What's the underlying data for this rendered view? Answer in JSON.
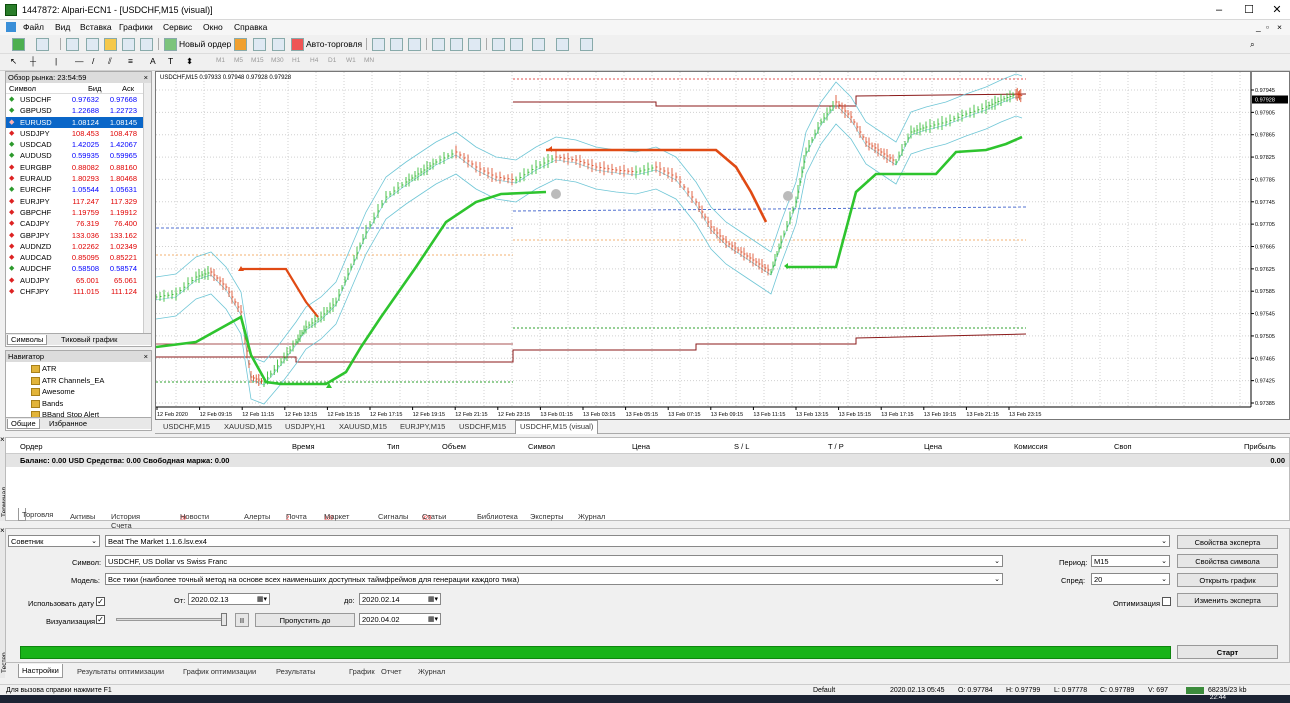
{
  "window": {
    "title": "1447872: Alpari-ECN1 - [USDCHF,M15 (visual)]"
  },
  "menu": [
    "Файл",
    "Вид",
    "Вставка",
    "Графики",
    "Сервис",
    "Окно",
    "Справка"
  ],
  "toolbar": {
    "new_order": "Новый ордер",
    "autotrading": "Авто-торговля",
    "timeframes": [
      "M1",
      "M5",
      "M15",
      "M30",
      "H1",
      "H4",
      "D1",
      "W1",
      "MN"
    ]
  },
  "market_watch": {
    "title": "Обзор рынка: 23:54:59",
    "col_symbol": "Символ",
    "col_bid": "Бид",
    "col_ask": "Аск",
    "rows": [
      {
        "symbol": "USDCHF",
        "bid": "0.97632",
        "ask": "0.97668",
        "dir": "up"
      },
      {
        "symbol": "GBPUSD",
        "bid": "1.22688",
        "ask": "1.22723",
        "dir": "up"
      },
      {
        "symbol": "EURUSD",
        "bid": "1.08124",
        "ask": "1.08145",
        "dir": "sel"
      },
      {
        "symbol": "USDJPY",
        "bid": "108.453",
        "ask": "108.478",
        "dir": "dn"
      },
      {
        "symbol": "USDCAD",
        "bid": "1.42025",
        "ask": "1.42067",
        "dir": "up"
      },
      {
        "symbol": "AUDUSD",
        "bid": "0.59935",
        "ask": "0.59965",
        "dir": "up"
      },
      {
        "symbol": "EURGBP",
        "bid": "0.88082",
        "ask": "0.88160",
        "dir": "dn"
      },
      {
        "symbol": "EURAUD",
        "bid": "1.80293",
        "ask": "1.80468",
        "dir": "dn"
      },
      {
        "symbol": "EURCHF",
        "bid": "1.05544",
        "ask": "1.05631",
        "dir": "up"
      },
      {
        "symbol": "EURJPY",
        "bid": "117.247",
        "ask": "117.329",
        "dir": "dn"
      },
      {
        "symbol": "GBPCHF",
        "bid": "1.19759",
        "ask": "1.19912",
        "dir": "dn"
      },
      {
        "symbol": "CADJPY",
        "bid": "76.319",
        "ask": "76.400",
        "dir": "dn"
      },
      {
        "symbol": "GBPJPY",
        "bid": "133.036",
        "ask": "133.162",
        "dir": "dn"
      },
      {
        "symbol": "AUDNZD",
        "bid": "1.02262",
        "ask": "1.02349",
        "dir": "dn"
      },
      {
        "symbol": "AUDCAD",
        "bid": "0.85095",
        "ask": "0.85221",
        "dir": "dn"
      },
      {
        "symbol": "AUDCHF",
        "bid": "0.58508",
        "ask": "0.58574",
        "dir": "up"
      },
      {
        "symbol": "AUDJPY",
        "bid": "65.001",
        "ask": "65.061",
        "dir": "dn"
      },
      {
        "symbol": "CHFJPY",
        "bid": "111.015",
        "ask": "111.124",
        "dir": "dn"
      }
    ],
    "tabs": [
      "Символы",
      "Тиковый график"
    ]
  },
  "navigator": {
    "title": "Навигатор",
    "items": [
      "ATR",
      "ATR Channels_EA",
      "Awesome",
      "Bands",
      "BBand Stop Alert"
    ],
    "tabs": [
      "Общие",
      "Избранное"
    ]
  },
  "chart": {
    "info": "USDCHF,M15  0.97933 0.97948 0.97928 0.97928",
    "current_price": "0.97928",
    "price_labels": [
      "0.97945",
      "0.97905",
      "0.97865",
      "0.97825",
      "0.97785",
      "0.97745",
      "0.97705",
      "0.97665",
      "0.97625",
      "0.97585",
      "0.97545",
      "0.97505",
      "0.97465",
      "0.97425",
      "0.97385"
    ],
    "time_labels": [
      "12 Feb 2020",
      "12 Feb 09:15",
      "12 Feb 11:15",
      "12 Feb 13:15",
      "12 Feb 15:15",
      "12 Feb 17:15",
      "12 Feb 19:15",
      "12 Feb 21:15",
      "12 Feb 23:15",
      "13 Feb 01:15",
      "13 Feb 03:15",
      "13 Feb 05:15",
      "13 Feb 07:15",
      "13 Feb 09:15",
      "13 Feb 11:15",
      "13 Feb 13:15",
      "13 Feb 15:15",
      "13 Feb 17:15",
      "13 Feb 19:15",
      "13 Feb 21:15",
      "13 Feb 23:15"
    ],
    "colors": {
      "bull": "#22b422",
      "bear": "#d9401a",
      "band": "#6fc6d6",
      "envelope": "#8b1a1a",
      "trail_up": "#2ec42e",
      "trail_dn": "#e04a14"
    }
  },
  "chart_tabs": [
    "USDCHF,M15",
    "XAUUSD,M15",
    "USDJPY,H1",
    "XAUUSD,M15",
    "EURJPY,M15",
    "USDCHF,M15",
    "USDCHF,M15 (visual)"
  ],
  "terminal": {
    "columns": [
      "Ордер",
      "Время",
      "Тип",
      "Объем",
      "Символ",
      "Цена",
      "S / L",
      "T / P",
      "Цена",
      "Комиссия",
      "Своп",
      "Прибыль"
    ],
    "balance": "Баланс: 0.00 USD  Средства: 0.00  Свободная маржа: 0.00",
    "balance_profit": "0.00",
    "side_label": "Терминал",
    "tabs": [
      {
        "label": "Торговля",
        "badge": ""
      },
      {
        "label": "Активы",
        "badge": ""
      },
      {
        "label": "История Счета",
        "badge": ""
      },
      {
        "label": "Новости",
        "badge": "28"
      },
      {
        "label": "Алерты",
        "badge": ""
      },
      {
        "label": "Почта",
        "badge": "2"
      },
      {
        "label": "Маркет",
        "badge": "135"
      },
      {
        "label": "Сигналы",
        "badge": ""
      },
      {
        "label": "Статьи",
        "badge": "928"
      },
      {
        "label": "Библиотека",
        "badge": ""
      },
      {
        "label": "Эксперты",
        "badge": ""
      },
      {
        "label": "Журнал",
        "badge": ""
      }
    ]
  },
  "tester": {
    "type": "Советник",
    "expert": "Beat The Market 1.1.6.lsv.ex4",
    "symbol_label": "Символ:",
    "symbol": "USDCHF, US Dollar vs Swiss Franc",
    "model_label": "Модель:",
    "model": "Все тики (наиболее точный метод на основе всех наименьших доступных таймфреймов для генерации каждого тика)",
    "use_date_label": "Использовать дату",
    "from_label": "От:",
    "from": "2020.02.13",
    "to_label": "до:",
    "to": "2020.02.14",
    "visual_label": "Визуализация",
    "skip_label": "Пропустить до",
    "skip_date": "2020.04.02",
    "pause_label": "II",
    "period_label": "Период:",
    "period": "M15",
    "spread_label": "Спред:",
    "spread": "20",
    "optimization_label": "Оптимизация",
    "buttons": {
      "expert_props": "Свойства эксперта",
      "symbol_props": "Свойства символа",
      "open_chart": "Открыть график",
      "modify_expert": "Изменить эксперта",
      "start": "Старт"
    },
    "progress": 1.0,
    "side_label": "Тестер",
    "tabs": [
      "Настройки",
      "Результаты оптимизации",
      "График оптимизации",
      "Результаты",
      "График",
      "Отчет",
      "Журнал"
    ]
  },
  "status": {
    "help": "Для вызова справки нажмите F1",
    "profile": "Default",
    "time": "2020.02.13 05:45",
    "open": "O: 0.97784",
    "high": "H: 0.97799",
    "low": "L: 0.97778",
    "close": "C: 0.97789",
    "volume": "V: 697",
    "traffic": "68235/23 kb"
  },
  "taskbar": {
    "clock": "22:44"
  }
}
